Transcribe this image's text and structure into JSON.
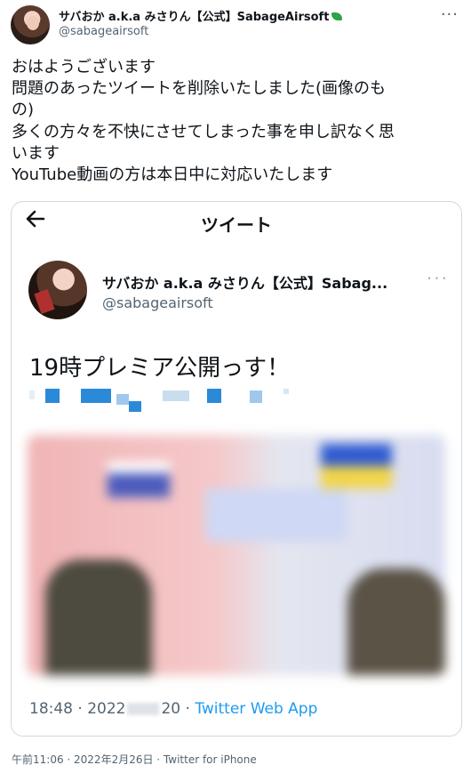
{
  "tweet": {
    "display_name": "サバおか a.k.a みさりん【公式】SabageAirsoft",
    "handle": "@sabageairsoft",
    "lines": [
      "おはようございます",
      "問題のあったツイートを削除いたしました(画像のも",
      "の)",
      "多くの方々を不快にさせてしまった事を申し訳なく思",
      "います",
      "YouTube動画の方は本日中に対応いたします"
    ],
    "footer": "午前11:06 · 2022年2月26日 · Twitter for iPhone"
  },
  "embedded": {
    "header_title": "ツイート",
    "display_name": "サバおか a.k.a みさりん【公式】Sabag...",
    "handle": "@sabageairsoft",
    "text": "19時プレミア公開っす！",
    "meta_time": "18:48 · 2022",
    "meta_sep": "20 · ",
    "meta_app": "Twitter Web App"
  },
  "colors": {
    "accent": "#1d9bf0",
    "secondary_text": "#536471",
    "border": "#cfd9de"
  }
}
